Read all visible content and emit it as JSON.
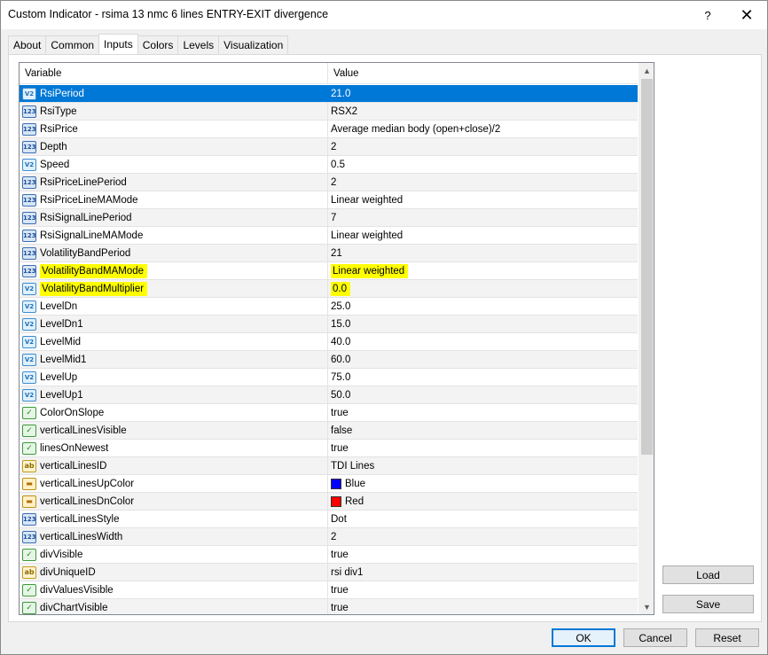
{
  "window": {
    "title": "Custom Indicator - rsima 13 nmc 6 lines ENTRY-EXIT divergence",
    "help_label": "?",
    "close_label": "✕"
  },
  "tabs": [
    {
      "label": "About"
    },
    {
      "label": "Common"
    },
    {
      "label": "Inputs",
      "active": true
    },
    {
      "label": "Colors"
    },
    {
      "label": "Levels"
    },
    {
      "label": "Visualization"
    }
  ],
  "grid": {
    "headers": {
      "variable": "Variable",
      "value": "Value"
    },
    "rows": [
      {
        "icon": "dbl",
        "icon_text": "V2",
        "name": "RsiPeriod",
        "value": "21.0",
        "selected": true
      },
      {
        "icon": "int",
        "icon_text": "123",
        "name": "RsiType",
        "value": "RSX2"
      },
      {
        "icon": "int",
        "icon_text": "123",
        "name": "RsiPrice",
        "value": "Average median body (open+close)/2"
      },
      {
        "icon": "int",
        "icon_text": "123",
        "name": "Depth",
        "value": "2"
      },
      {
        "icon": "dbl",
        "icon_text": "V2",
        "name": "Speed",
        "value": "0.5"
      },
      {
        "icon": "int",
        "icon_text": "123",
        "name": "RsiPriceLinePeriod",
        "value": "2"
      },
      {
        "icon": "int",
        "icon_text": "123",
        "name": "RsiPriceLineMAMode",
        "value": "Linear weighted"
      },
      {
        "icon": "int",
        "icon_text": "123",
        "name": "RsiSignalLinePeriod",
        "value": "7"
      },
      {
        "icon": "int",
        "icon_text": "123",
        "name": "RsiSignalLineMAMode",
        "value": "Linear weighted"
      },
      {
        "icon": "int",
        "icon_text": "123",
        "name": "VolatilityBandPeriod",
        "value": "21"
      },
      {
        "icon": "int",
        "icon_text": "123",
        "name": "VolatilityBandMAMode",
        "value": "Linear weighted",
        "highlight": true
      },
      {
        "icon": "dbl",
        "icon_text": "V2",
        "name": "VolatilityBandMultiplier",
        "value": "0.0",
        "highlight": true
      },
      {
        "icon": "dbl",
        "icon_text": "V2",
        "name": "LevelDn",
        "value": "25.0"
      },
      {
        "icon": "dbl",
        "icon_text": "V2",
        "name": "LevelDn1",
        "value": "15.0"
      },
      {
        "icon": "dbl",
        "icon_text": "V2",
        "name": "LevelMid",
        "value": "40.0"
      },
      {
        "icon": "dbl",
        "icon_text": "V2",
        "name": "LevelMid1",
        "value": "60.0"
      },
      {
        "icon": "dbl",
        "icon_text": "V2",
        "name": "LevelUp",
        "value": "75.0"
      },
      {
        "icon": "dbl",
        "icon_text": "V2",
        "name": "LevelUp1",
        "value": "50.0"
      },
      {
        "icon": "bool",
        "icon_text": "✓",
        "name": "ColorOnSlope",
        "value": "true"
      },
      {
        "icon": "bool",
        "icon_text": "✓",
        "name": "verticalLinesVisible",
        "value": "false"
      },
      {
        "icon": "bool",
        "icon_text": "✓",
        "name": "linesOnNewest",
        "value": "true"
      },
      {
        "icon": "str",
        "icon_text": "ab",
        "name": "verticalLinesID",
        "value": "TDI Lines"
      },
      {
        "icon": "clr",
        "icon_text": "▬",
        "name": "verticalLinesUpColor",
        "value": "Blue",
        "swatch": "#0000ff"
      },
      {
        "icon": "clr",
        "icon_text": "▬",
        "name": "verticalLinesDnColor",
        "value": "Red",
        "swatch": "#ff0000"
      },
      {
        "icon": "int",
        "icon_text": "123",
        "name": "verticalLinesStyle",
        "value": "Dot"
      },
      {
        "icon": "int",
        "icon_text": "123",
        "name": "verticalLinesWidth",
        "value": "2"
      },
      {
        "icon": "bool",
        "icon_text": "✓",
        "name": "divVisible",
        "value": "true"
      },
      {
        "icon": "str",
        "icon_text": "ab",
        "name": "divUniqueID",
        "value": "rsi div1"
      },
      {
        "icon": "bool",
        "icon_text": "✓",
        "name": "divValuesVisible",
        "value": "true"
      },
      {
        "icon": "bool",
        "icon_text": "✓",
        "name": "divChartVisible",
        "value": "true"
      }
    ]
  },
  "side_buttons": {
    "load": "Load",
    "save": "Save"
  },
  "bottom_buttons": {
    "ok": "OK",
    "cancel": "Cancel",
    "reset": "Reset"
  },
  "scrollbar": {
    "up_arrow": "▲",
    "down_arrow": "▼"
  },
  "colors": {
    "selection": "#0078d7",
    "highlight": "#ffff00",
    "blue_swatch": "#0000ff",
    "red_swatch": "#ff0000"
  }
}
